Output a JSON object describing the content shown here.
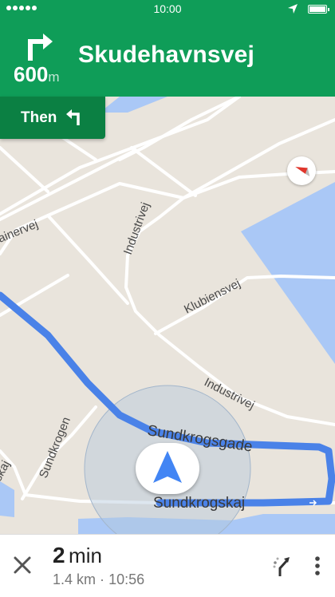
{
  "status_bar": {
    "time": "10:00"
  },
  "navigation": {
    "distance_value": "600",
    "distance_unit": "m",
    "street": "Skudehavnsvej",
    "then_label": "Then",
    "turn_icon": "turn-right-icon",
    "then_icon": "turn-left-icon"
  },
  "map": {
    "streets": [
      "ainervej",
      "Industrivej",
      "Klubiensvej",
      "Industrivej",
      "Sundkrogen",
      "Sundkrogsgade",
      "Sundkrogskaj",
      "skaj"
    ]
  },
  "eta": {
    "value": "2",
    "unit": "min",
    "distance": "1.4 km",
    "separator": "·",
    "arrival": "10:56"
  },
  "colors": {
    "header": "#0f9d58",
    "then": "#0b8043",
    "route": "#4a82e8",
    "water": "#aac8f6"
  }
}
